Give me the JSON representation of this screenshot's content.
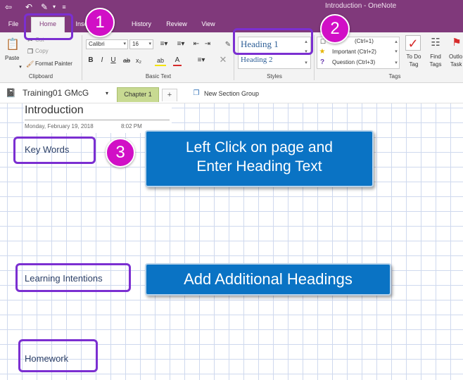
{
  "window": {
    "title": "Introduction  -  OneNote"
  },
  "quick_access": {
    "back_icon": "back-arrow-icon",
    "undo_icon": "undo-icon",
    "pen_icon": "pen-icon"
  },
  "tabs": [
    {
      "label": "File"
    },
    {
      "label": "Home"
    },
    {
      "label": "Inse"
    },
    {
      "label": "History"
    },
    {
      "label": "Review"
    },
    {
      "label": "View"
    }
  ],
  "clipboard": {
    "paste": "Paste",
    "cut": "Cut",
    "copy": "Copy",
    "format_painter": "Format Painter",
    "group_label": "Clipboard"
  },
  "basic_text": {
    "font_name": "Calibri",
    "font_size": "16",
    "group_label": "Basic Text"
  },
  "styles": {
    "items": [
      "Heading 1",
      "Heading 2"
    ],
    "group_label": "Styles"
  },
  "tags": {
    "items": [
      {
        "label": "(Ctrl+1)",
        "icon": "checkbox-icon"
      },
      {
        "label": "Important (Ctrl+2)",
        "icon": "star-icon"
      },
      {
        "label": "Question (Ctrl+3)",
        "icon": "question-icon"
      }
    ],
    "todo_line1": "To Do",
    "todo_line2": "Tag",
    "find_line1": "Find",
    "find_line2": "Tags",
    "outlook_line1": "Outlo",
    "outlook_line2": "Task",
    "group_label": "Tags"
  },
  "notebook": {
    "name": "Training01 GMcG",
    "section": "Chapter 1",
    "add_section": "+",
    "new_section_group": "New Section Group"
  },
  "page": {
    "title": "Introduction",
    "date": "Monday, February 19, 2018",
    "time": "8:02 PM",
    "headings": [
      "Key Words",
      "Learning Intentions",
      "Homework"
    ]
  },
  "annotations": {
    "badges": [
      "1",
      "2",
      "3"
    ],
    "instruction_1_line1": "Left Click on page and",
    "instruction_1_line2": "Enter Heading Text",
    "instruction_2": "Add Additional Headings"
  },
  "colors": {
    "onenote_purple": "#80397b",
    "callout_purple": "#7b2fd1",
    "badge_magenta": "#d10fc6",
    "instruction_blue": "#0a73c4"
  }
}
